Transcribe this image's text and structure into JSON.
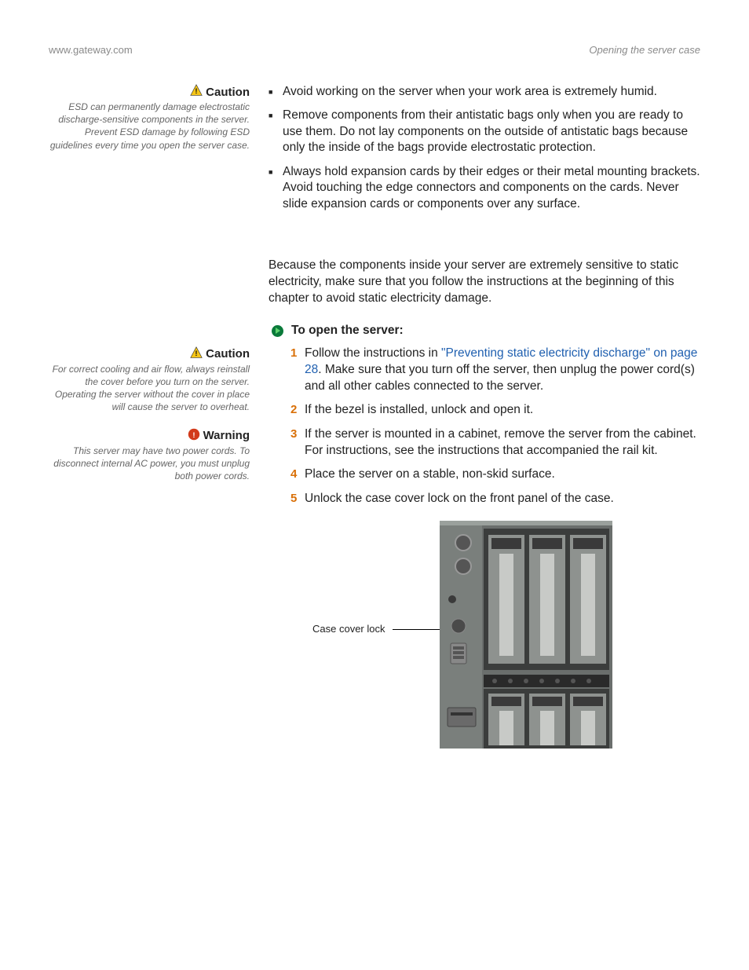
{
  "header": {
    "left": "www.gateway.com",
    "right": "Opening the server case"
  },
  "sidebar": {
    "caution1": {
      "label": "Caution",
      "text": "ESD can permanently damage electrostatic discharge-sensitive components in the server. Prevent ESD damage by following ESD guidelines every time you open the server case."
    },
    "caution2": {
      "label": "Caution",
      "text": "For correct cooling and air flow, always reinstall the cover before you turn on the server. Operating the server without the cover in place will cause the server to overheat."
    },
    "warning": {
      "label": "Warning",
      "text": "This server may have two power cords. To disconnect internal AC power, you must unplug both power cords."
    }
  },
  "bullets": [
    "Avoid working on the server when your work area is extremely humid.",
    "Remove components from their antistatic bags only when you are ready to use them. Do not lay components on the outside of antistatic bags because only the inside of the bags provide electrostatic protection.",
    "Always hold expansion cards by their edges or their metal mounting brackets. Avoid touching the edge connectors and components on the cards. Never slide expansion cards or components over any surface."
  ],
  "intro": "Because the components inside your server are extremely sensitive to static electricity, make sure that you follow the instructions at the beginning of this chapter to avoid static electricity damage.",
  "task": {
    "title": "To open the server:",
    "steps": {
      "s1pre": "Follow the instructions in ",
      "s1link": "\"Preventing static electricity discharge\" on page 28",
      "s1post": ". Make sure that you turn off the server, then unplug the power cord(s) and all other cables connected to the server.",
      "s2": "If the bezel is installed, unlock and open it.",
      "s3": "If the server is mounted in a cabinet, remove the server from the cabinet. For instructions, see the instructions that accompanied the rail kit.",
      "s4": "Place the server on a stable, non-skid surface.",
      "s5": "Unlock the case cover lock on the front panel of the case."
    }
  },
  "figure": {
    "callout": "Case cover lock"
  }
}
